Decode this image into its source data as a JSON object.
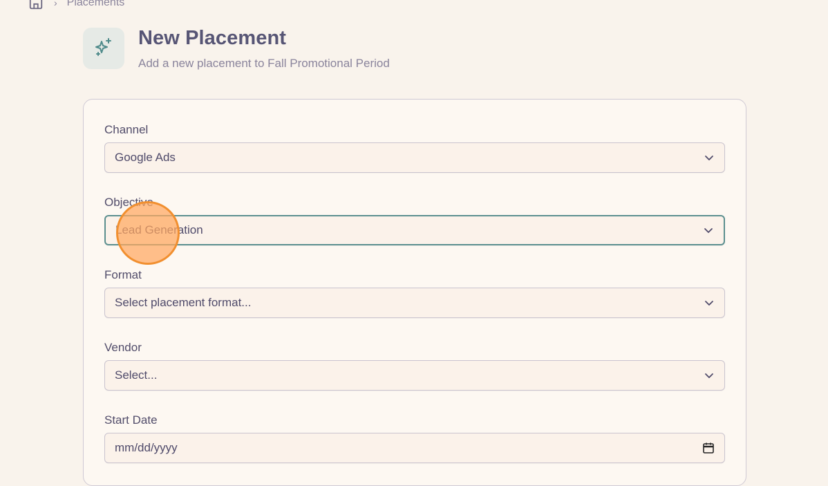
{
  "breadcrumb": {
    "separator": "›",
    "current": "Placements"
  },
  "header": {
    "title": "New Placement",
    "subtitle": "Add a new placement to Fall Promotional Period",
    "icon": "sparkles-icon"
  },
  "form": {
    "channel": {
      "label": "Channel",
      "value": "Google Ads"
    },
    "objective": {
      "label": "Objective",
      "value": "Lead Generation"
    },
    "format": {
      "label": "Format",
      "value": "Select placement format..."
    },
    "vendor": {
      "label": "Vendor",
      "value": "Select..."
    },
    "start_date": {
      "label": "Start Date",
      "value": "mm/dd/yyyy"
    }
  },
  "colors": {
    "background": "#f9f3ec",
    "accent_focus": "#5b8f8f",
    "cursor": "#f18f2f"
  }
}
